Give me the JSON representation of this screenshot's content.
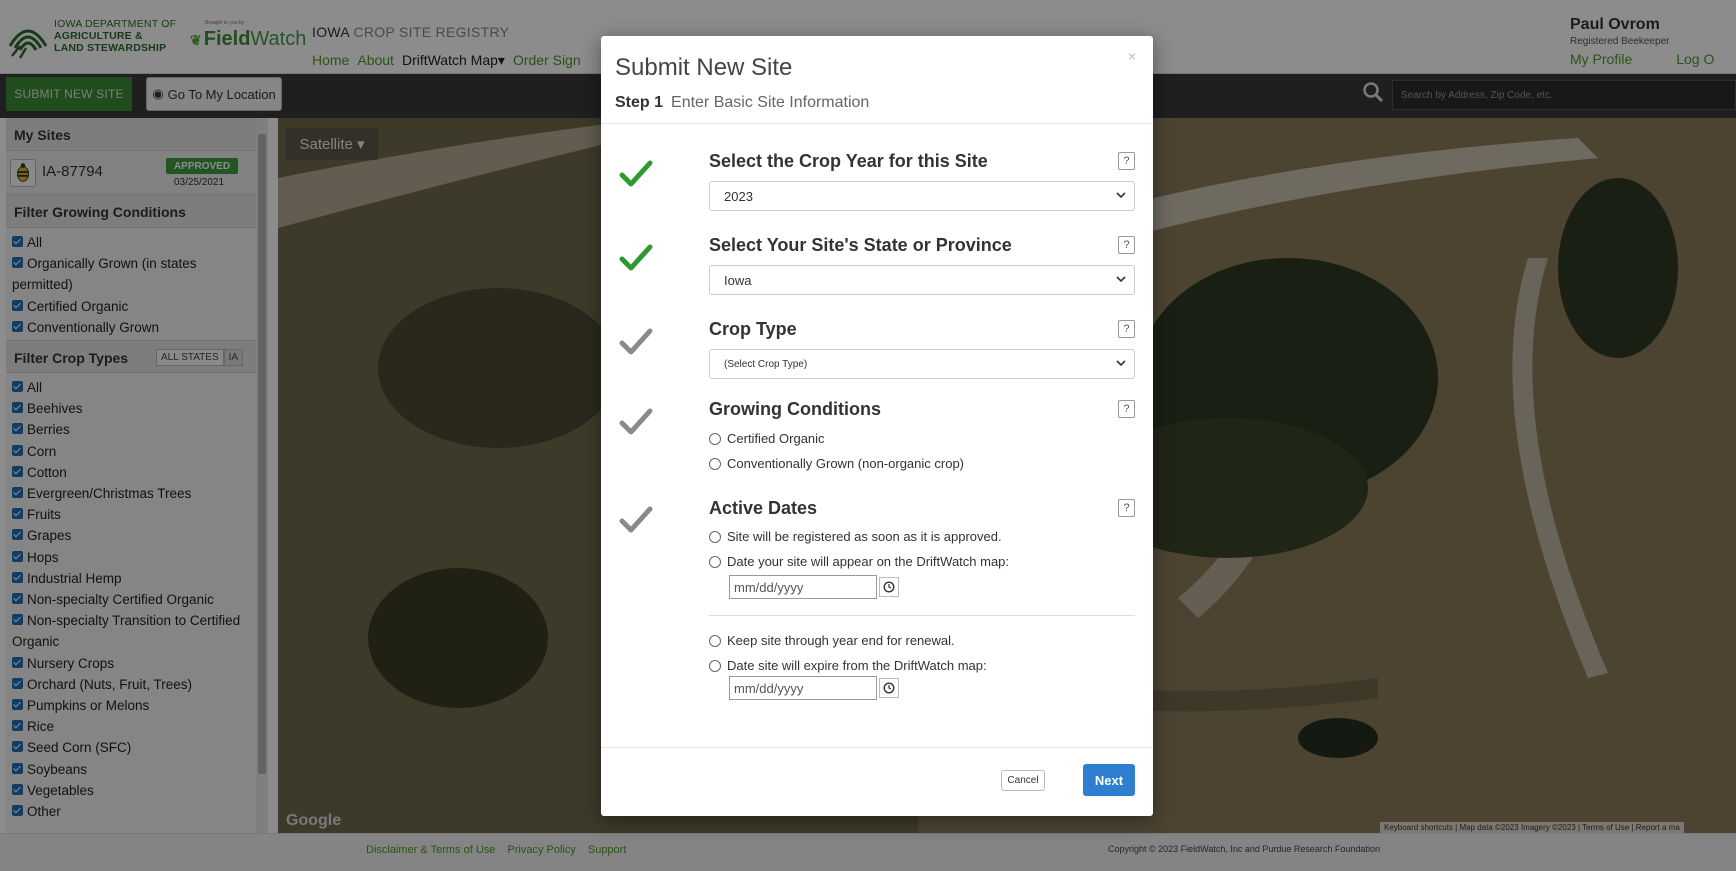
{
  "header": {
    "logo_line1": "IOWA DEPARTMENT OF",
    "logo_line2": "AGRICULTURE &",
    "logo_line3": "LAND STEWARDSHIP",
    "brought_by": "Brought to you by",
    "fieldwatch_field": "Field",
    "fieldwatch_watch": "Watch",
    "site_title_a": "IOWA ",
    "site_title_b": "CROP SITE REGISTRY",
    "nav": [
      "Home",
      "About",
      "DriftWatch Map▾",
      "Order Sign"
    ],
    "user_name": "Paul Ovrom",
    "user_role": "Registered Beekeeper",
    "profile_link": "My Profile",
    "logout_link": "Log O"
  },
  "toolbar": {
    "submit_label": "SUBMIT NEW SITE",
    "location_label": "Go To My Location",
    "search_placeholder": "Search by Address, Zip Code, etc."
  },
  "sidebar": {
    "my_sites_title": "My Sites",
    "site": {
      "id": "IA-87794",
      "status": "APPROVED",
      "date": "03/25/2021"
    },
    "growing_title": "Filter Growing Conditions",
    "growing_items": [
      "All",
      "Organically Grown (in states",
      "permitted)",
      "Certified Organic",
      "Conventionally Grown"
    ],
    "crop_title": "Filter Crop Types",
    "toggle_all": "ALL STATES",
    "toggle_ia": "IA",
    "crop_items": [
      "All",
      "Beehives",
      "Berries",
      "Corn",
      "Cotton",
      "Evergreen/Christmas Trees",
      "Fruits",
      "Grapes",
      "Hops",
      "Industrial Hemp",
      "Non-specialty Certified Organic",
      "Non-specialty Transition to Certified",
      "Organic",
      "Nursery Crops",
      "Orchard (Nuts, Fruit, Trees)",
      "Pumpkins or Melons",
      "Rice",
      "Seed Corn (SFC)",
      "Soybeans",
      "Vegetables",
      "Other"
    ]
  },
  "map": {
    "satellite_label": "Satellite ▾",
    "google_label": "Google",
    "attribution": "Keyboard shortcuts | Map data ©2023 Imagery ©2023 | Terms of Use | Report a ma"
  },
  "footer": {
    "links": [
      "Disclaimer & Terms of Use",
      "Privacy Policy",
      "Support"
    ],
    "copyright": "Copyright © 2023 FieldWatch, Inc and Purdue Research Foundation"
  },
  "modal": {
    "title": "Submit New Site",
    "close": "×",
    "step_num": "Step 1",
    "step_label": "Enter Basic Site Information",
    "help": "?",
    "crop_year_title": "Select the Crop Year for this Site",
    "crop_year_value": "2023",
    "state_title": "Select Your Site's State or Province",
    "state_value": "Iowa",
    "crop_type_title": "Crop Type",
    "crop_type_value": "(Select Crop Type)",
    "growing_title": "Growing Conditions",
    "growing_opt1": "Certified Organic",
    "growing_opt2": "Conventionally Grown (non-organic crop)",
    "dates_title": "Active Dates",
    "date_opt1": "Site will be registered as soon as it is approved.",
    "date_opt2": "Date your site will appear on the DriftWatch map:",
    "date_placeholder": "mm/dd/yyyy",
    "date_opt3": "Keep site through year end for renewal.",
    "date_opt4": "Date site will expire from the DriftWatch map:",
    "cancel": "Cancel",
    "next": "Next"
  },
  "colors": {
    "accent_green": "#3d8b37",
    "check_done": "#2e9a2e",
    "check_pending": "#8a8a8a",
    "primary_blue": "#2f7fd0"
  }
}
